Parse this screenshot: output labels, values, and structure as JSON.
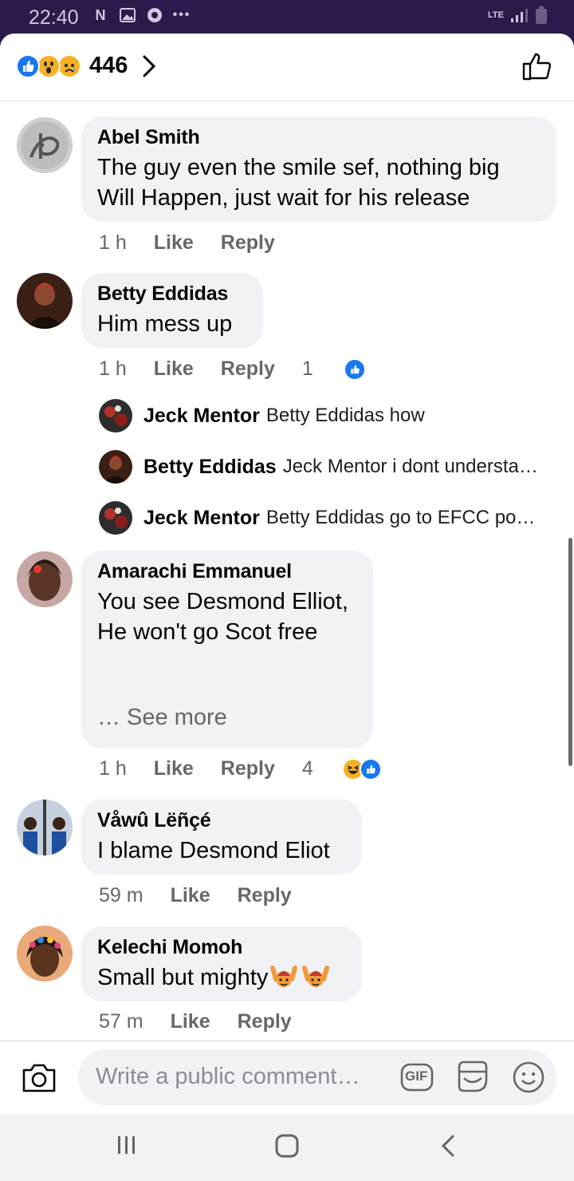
{
  "status_bar": {
    "time": "22:40",
    "network": "LTE"
  },
  "header": {
    "reaction_count": "446",
    "reaction_icons": [
      "like-icon",
      "wow-icon",
      "sad-icon"
    ]
  },
  "comments": [
    {
      "author": "Abel Smith",
      "text": "The guy even the smile sef, nothing big\nWill Happen, just wait for his release",
      "time": "1 h",
      "like": "Like",
      "reply": "Reply"
    },
    {
      "author": "Betty Eddidas",
      "text": "Him mess up",
      "time": "1 h",
      "like": "Like",
      "reply": "Reply",
      "reaction_count": "1",
      "replies": [
        {
          "author": "Jeck Mentor",
          "text": "Betty Eddidas  how"
        },
        {
          "author": "Betty Eddidas",
          "text": "Jeck Mentor i dont understa…"
        },
        {
          "author": "Jeck Mentor",
          "text": "Betty Eddidas  go to EFCC po…"
        }
      ]
    },
    {
      "author": "Amarachi Emmanuel",
      "text": "You see Desmond Elliot,\nHe won't go Scot free",
      "see_more": "… See more",
      "time": "1 h",
      "like": "Like",
      "reply": "Reply",
      "reaction_count": "4"
    },
    {
      "author": "Våwû Lëñçé",
      "text": "I blame Desmond Eliot",
      "time": "59 m",
      "like": "Like",
      "reply": "Reply"
    },
    {
      "author": "Kelechi Momoh",
      "text": "Small but mighty",
      "time": "57 m",
      "like": "Like",
      "reply": "Reply"
    }
  ],
  "composer": {
    "placeholder": "Write a public comment…",
    "gif_label": "GIF"
  },
  "colors": {
    "accent": "#1877f2",
    "bubble": "#f0f2f5",
    "meta": "#65676b",
    "statusbar": "#2b1b4d"
  }
}
